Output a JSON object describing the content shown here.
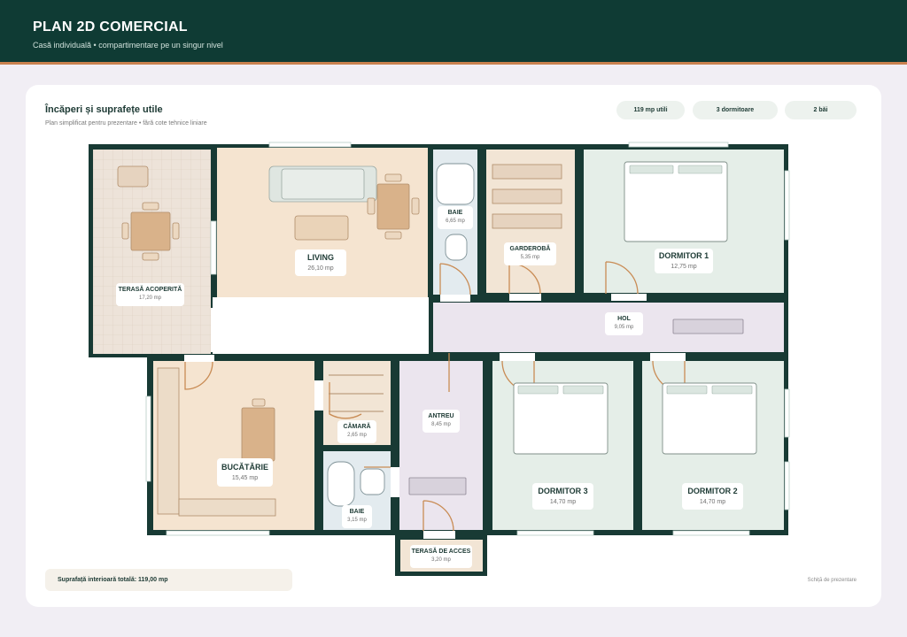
{
  "header": {
    "title": "PLAN 2D COMERCIAL",
    "subtitle": "Casă individuală • compartimentare pe un singur nivel"
  },
  "card": {
    "title": "Încăperi și suprafețe utile",
    "subtitle": "Plan simplificat pentru prezentare • fără cote tehnice liniare"
  },
  "pills": {
    "useful_area": "119 mp utili",
    "bedrooms": "3 dormitoare",
    "bathrooms": "2 băi"
  },
  "rooms": {
    "terasa_acoperita": {
      "name": "TERASĂ ACOPERITĂ",
      "area": "17,20 mp"
    },
    "living": {
      "name": "LIVING",
      "area": "26,10 mp"
    },
    "baie_1": {
      "name": "BAIE",
      "area": "6,65 mp"
    },
    "garderoba": {
      "name": "GARDEROBĂ",
      "area": "5,35 mp"
    },
    "dormitor_1": {
      "name": "DORMITOR 1",
      "area": "12,75 mp"
    },
    "hol": {
      "name": "HOL",
      "area": "9,05 mp"
    },
    "bucatarie": {
      "name": "BUCĂTĂRIE",
      "area": "15,45 mp"
    },
    "camara": {
      "name": "CĂMARĂ",
      "area": "2,65 mp"
    },
    "baie_2": {
      "name": "BAIE",
      "area": "3,15 mp"
    },
    "antreu": {
      "name": "ANTREU",
      "area": "8,45 mp"
    },
    "dormitor_3": {
      "name": "DORMITOR 3",
      "area": "14,70 mp"
    },
    "dormitor_2": {
      "name": "DORMITOR 2",
      "area": "14,70 mp"
    },
    "terasa_acces": {
      "name": "TERASĂ DE ACCES",
      "area": "3,20 mp"
    }
  },
  "footer": {
    "total": "Suprafață interioară totală: 119,00 mp",
    "note": "Schiță de prezentare"
  },
  "colors": {
    "wall": "#183a34",
    "terrace": "#ede3d9",
    "living": "#f5e4d0",
    "bath": "#e3ebef",
    "wardrobe": "#f2e5d5",
    "bedroom": "#e5eee8",
    "hall": "#ebe5ee",
    "kitchen": "#f5e4d0",
    "door": "#c98c55"
  }
}
